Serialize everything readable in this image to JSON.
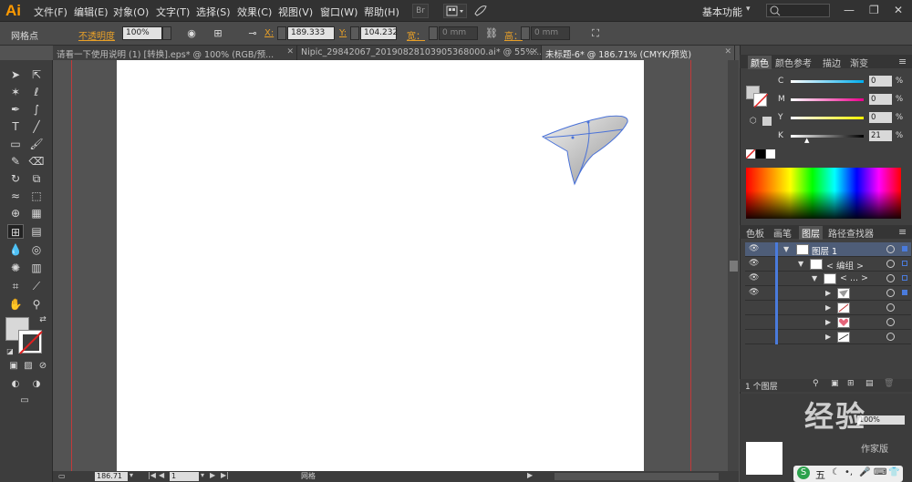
{
  "app": {
    "logo": "Ai",
    "workspace": "基本功能"
  },
  "menu": [
    "文件(F)",
    "编辑(E)",
    "对象(O)",
    "文字(T)",
    "选择(S)",
    "效果(C)",
    "视图(V)",
    "窗口(W)",
    "帮助(H)"
  ],
  "menu_buttons": [
    "Br"
  ],
  "control": {
    "tool_label": "网格点",
    "opacity_label": "不透明度",
    "opacity_value": "100%",
    "x_label": "X:",
    "x_value": "189.333",
    "y_label": "Y:",
    "y_value": "104.232",
    "w_label": "宽：",
    "w_value": "0 mm",
    "h_label": "高：",
    "h_value": "0 mm"
  },
  "tabs": [
    {
      "label": "请看一下使用说明 (1) [转换].eps* @ 100% (RGB/预..."
    },
    {
      "label": "Nipic_29842067_20190828103905368000.ai* @ 55%..."
    },
    {
      "label": "未标题-6* @ 186.71% (CMYK/预览)"
    }
  ],
  "color_panel": {
    "tabs": [
      "颜色",
      "颜色参考",
      "描边",
      "渐变"
    ],
    "sliders": [
      {
        "label": "C",
        "value": "0",
        "color": "#00aeef"
      },
      {
        "label": "M",
        "value": "0",
        "color": "#ec008c"
      },
      {
        "label": "Y",
        "value": "0",
        "color": "#fff200"
      },
      {
        "label": "K",
        "value": "21",
        "color": "#000000"
      }
    ],
    "percent": "%"
  },
  "layers_panel": {
    "tabs": [
      "色板",
      "画笔",
      "图层",
      "路径查找器"
    ],
    "rows": [
      {
        "label": "图层 1"
      },
      {
        "label": "< 编组 >"
      },
      {
        "label": "< ... >"
      }
    ],
    "footer": "1 个图层"
  },
  "status": {
    "zoom": "186.71",
    "page": "1",
    "tool": "网格"
  },
  "watermark": {
    "text": "经验",
    "sub": "作家版"
  },
  "ime": {
    "label": "五"
  }
}
